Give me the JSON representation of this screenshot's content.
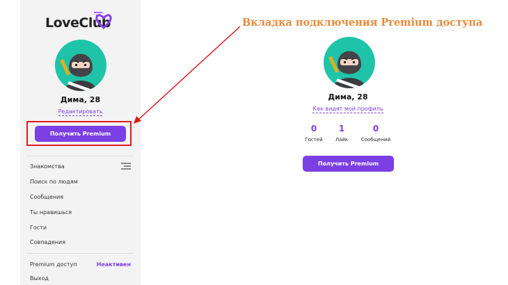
{
  "app": {
    "logo_text": "LoveClub"
  },
  "profile": {
    "name": "Дима, 28"
  },
  "sidebar": {
    "edit_label": "Редактировать",
    "premium_button": "Получить Premium",
    "menu": [
      {
        "label": "Знакомства"
      },
      {
        "label": "Поиск по людям"
      },
      {
        "label": "Сообщения"
      },
      {
        "label": "Ты нравишься"
      },
      {
        "label": "Гости"
      },
      {
        "label": "Совпадения"
      }
    ],
    "premium_access_label": "Premium доступ",
    "premium_status": "Неактивен",
    "logout_label": "Выход"
  },
  "main": {
    "view_profile_label": "Как видят мой профиль",
    "stats": [
      {
        "value": "0",
        "label": "Гостей"
      },
      {
        "value": "1",
        "label": "Лайк"
      },
      {
        "value": "0",
        "label": "Сообщений"
      }
    ],
    "premium_button": "Получить Premium"
  },
  "annotation": {
    "text": "Вкладка подключения Premium доступа"
  },
  "colors": {
    "accent": "#7b3fe4",
    "avatar_bg": "#1fc4a8",
    "annotation": "#e8893a",
    "highlight": "#e01818"
  }
}
